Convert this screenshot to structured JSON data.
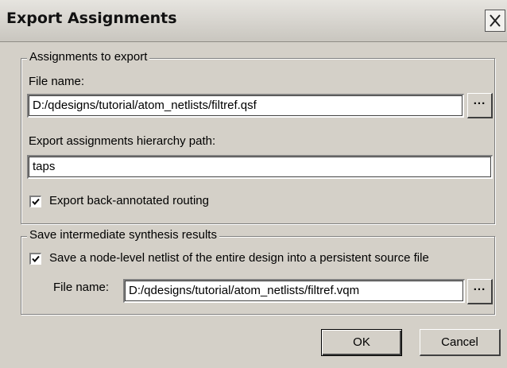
{
  "window": {
    "title": "Export Assignments",
    "close_icon": "close-icon"
  },
  "assignments_group": {
    "legend": "Assignments to export",
    "file_name_label": "File name:",
    "file_name_value": "D:/qdesigns/tutorial/atom_netlists/filtref.qsf",
    "browse_label": "...",
    "hierarchy_label": "Export assignments hierarchy path:",
    "hierarchy_value": "taps",
    "back_annotated_label": "Export back-annotated routing",
    "back_annotated_checked": true
  },
  "synthesis_group": {
    "legend": "Save intermediate synthesis results",
    "netlist_label": "Save a node-level netlist of the entire design into a persistent source file",
    "netlist_checked": true,
    "file_name_label": "File name:",
    "file_name_value": "D:/qdesigns/tutorial/atom_netlists/filtref.vqm",
    "browse_label": "..."
  },
  "buttons": {
    "ok": "OK",
    "cancel": "Cancel"
  },
  "colors": {
    "face": "#d4d0c8",
    "field": "#ffffff",
    "shadow": "#808080"
  }
}
